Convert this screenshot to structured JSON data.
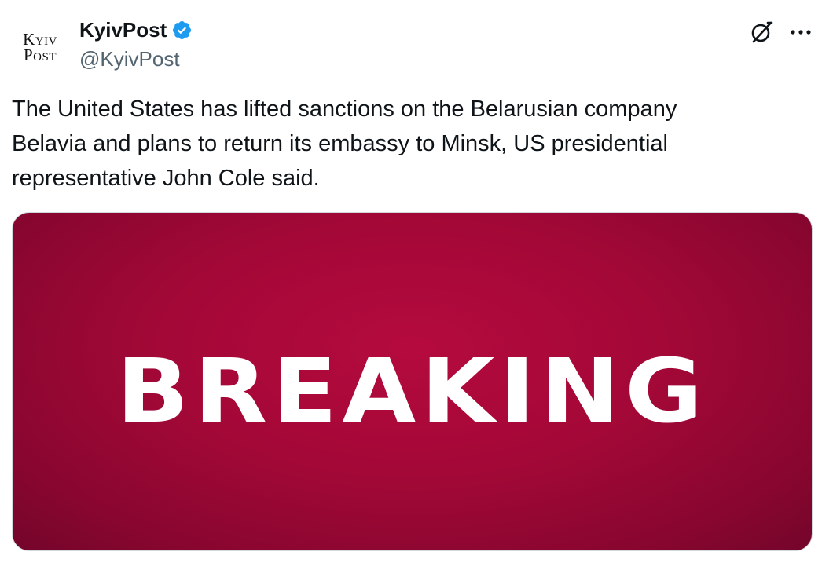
{
  "author": {
    "avatar_line1": "Kyiv",
    "avatar_line2": "Post",
    "display_name": "KyivPost",
    "handle": "@KyivPost",
    "verified": true
  },
  "tweet": {
    "text": "The United States has lifted sanctions on the Belarusian company\nBelavia and plans to return its embassy to Minsk, US presidential\nrepresentative John Cole said."
  },
  "media": {
    "headline": "BREAKING",
    "background_color": "#a30837",
    "text_color": "#ffffff"
  },
  "actions": {
    "grok_icon": "grok-icon",
    "more_icon": "more-options-icon"
  },
  "colors": {
    "text": "#0f1419",
    "secondary": "#536471",
    "verified_badge": "#1d9bf0"
  }
}
